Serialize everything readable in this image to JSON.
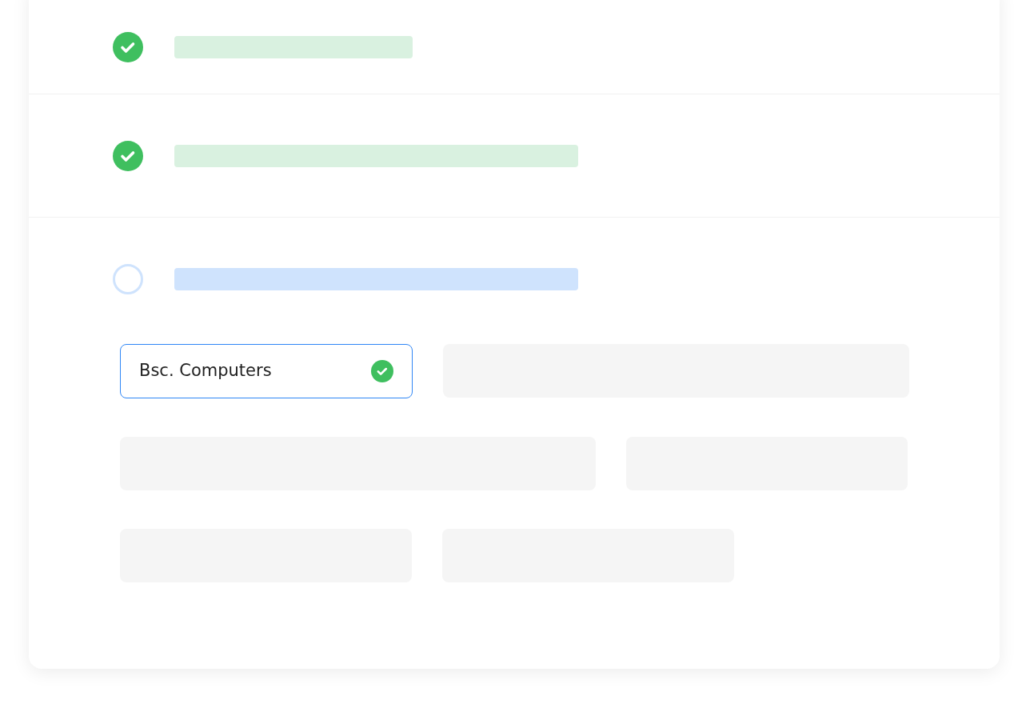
{
  "steps": [
    {
      "done": true
    },
    {
      "done": true
    },
    {
      "done": false
    }
  ],
  "degree_field": {
    "value": "Bsc. Computers",
    "valid": true
  }
}
